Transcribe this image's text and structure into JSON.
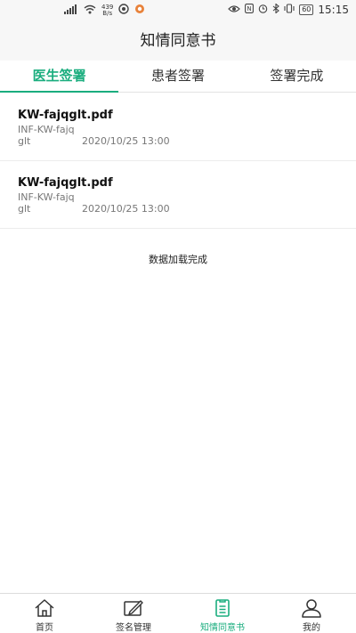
{
  "status_bar": {
    "net_speed_value": "439",
    "net_speed_unit": "B/s",
    "battery": "60",
    "time": "15:15"
  },
  "header": {
    "title": "知情同意书"
  },
  "tabs": [
    {
      "label": "医生签署",
      "active": true
    },
    {
      "label": "患者签署",
      "active": false
    },
    {
      "label": "签署完成",
      "active": false
    }
  ],
  "documents": [
    {
      "name": "KW-fajqglt.pdf",
      "code": "INF-KW-fajq",
      "user": "glt",
      "datetime": "2020/10/25 13:00"
    },
    {
      "name": "KW-fajqglt.pdf",
      "code": "INF-KW-fajq",
      "user": "glt",
      "datetime": "2020/10/25 13:00"
    }
  ],
  "load_status": "数据加载完成",
  "bottom_nav": [
    {
      "label": "首页",
      "icon": "home-icon",
      "active": false
    },
    {
      "label": "签名管理",
      "icon": "signature-icon",
      "active": false
    },
    {
      "label": "知情同意书",
      "icon": "document-icon",
      "active": true
    },
    {
      "label": "我的",
      "icon": "profile-icon",
      "active": false
    }
  ],
  "colors": {
    "accent": "#1aad7e",
    "background": "#ffffff",
    "bar": "#f7f7f7"
  }
}
